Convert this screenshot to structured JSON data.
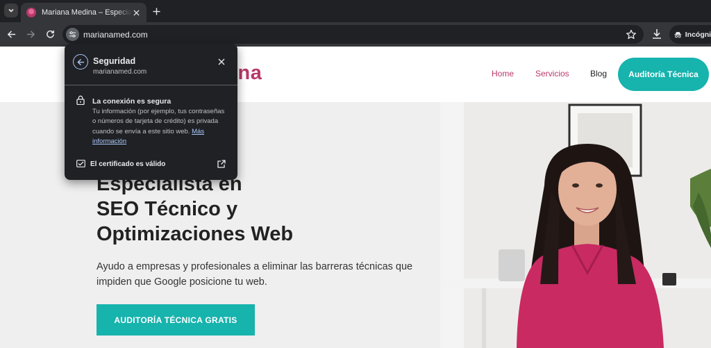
{
  "browser": {
    "tab": {
      "title": "Mariana Medina – Especialista en SEO Técnico"
    },
    "omnibox": {
      "url": "marianamed.com"
    },
    "incognito_label": "Incógnito"
  },
  "site": {
    "logo_visible": "ina",
    "nav": {
      "home": "Home",
      "services": "Servicios",
      "blog": "Blog"
    },
    "header_cta": "Auditoría Técnica",
    "hero": {
      "title_lines": [
        "Especialista en",
        "SEO Técnico y",
        "Optimizaciones Web"
      ],
      "description": "Ayudo a empresas y profesionales a eliminar las barreras técnicas que impiden que Google posicione tu web.",
      "cta": "AUDITORÍA TÉCNICA GRATIS"
    }
  },
  "security_popup": {
    "title": "Seguridad",
    "domain": "marianamed.com",
    "connection_title": "La conexión es segura",
    "connection_desc": "Tu información (por ejemplo, tus contraseñas o números de tarjeta de crédito) es privada cuando se envía a este sitio web.",
    "more_info_link": "Más información",
    "certificate_label": "El certificado es válido"
  },
  "colors": {
    "brand_pink": "#b8386a",
    "brand_teal": "#17b3ad",
    "chrome_dark": "#202124"
  }
}
